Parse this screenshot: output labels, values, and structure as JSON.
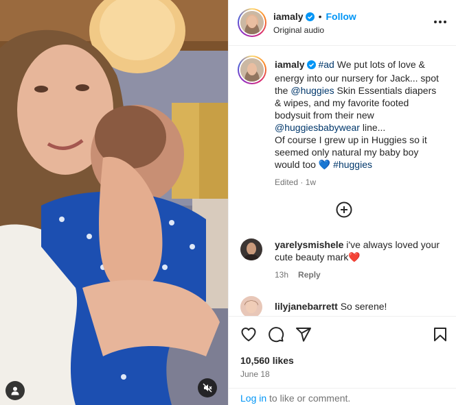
{
  "post": {
    "username": "iamaly",
    "separator": "•",
    "follow_label": "Follow",
    "audio": "Original audio",
    "caption_hashtag_ad": "#ad",
    "caption_part1": " We put lots of love & energy into our nursery for Jack... spot the ",
    "caption_mention1": "@huggies",
    "caption_part2": " Skin Essentials diapers & wipes, and my favorite footed bodysuit from their new ",
    "caption_mention2": "@huggiesbabywear",
    "caption_part3": " line...",
    "caption_part4": "Of course I grew up in Huggies so it seemed only natural my baby boy would too ",
    "caption_heart": "💙",
    "caption_hashtag2": "#huggies",
    "edited": "Edited",
    "edited_sep": " · ",
    "edited_time": "1w",
    "likes": "10,560 likes",
    "date": "June 18"
  },
  "comments": [
    {
      "username": "yarelysmishele",
      "text": "i've always loved your cute beauty mark",
      "emoji": "❤️",
      "time": "13h",
      "reply_label": "Reply"
    },
    {
      "username": "lilyjanebarrett",
      "text": "So serene!"
    }
  ],
  "footer": {
    "login_label": "Log in",
    "login_suffix": " to like or comment."
  },
  "icons": [
    "verified-badge-icon",
    "more-options-icon",
    "add-comment-icon",
    "heart-icon",
    "comment-icon",
    "share-icon",
    "save-icon",
    "user-tag-icon",
    "muted-audio-icon"
  ],
  "colors": {
    "follow": "#0095f6",
    "link": "#00376b",
    "verified": "#0095f6",
    "muted_text": "#737373"
  }
}
